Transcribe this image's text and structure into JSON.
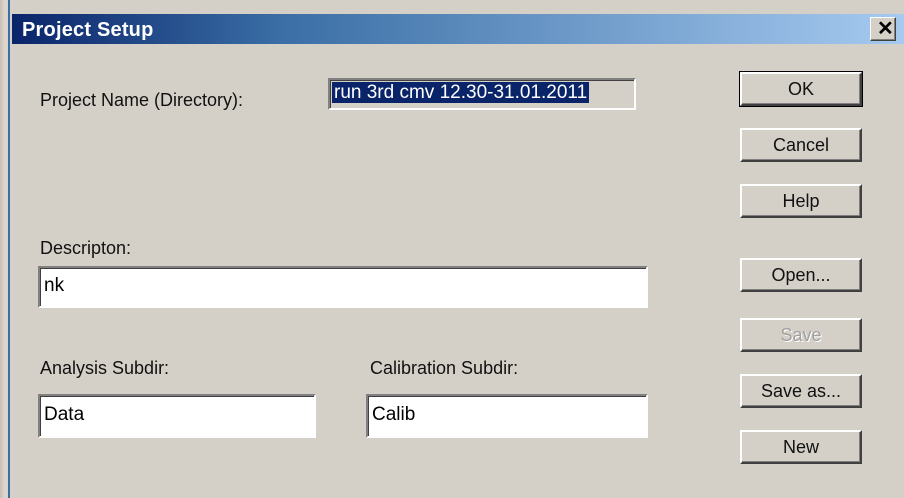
{
  "window": {
    "title": "Project Setup",
    "close_glyph": "✕"
  },
  "fields": {
    "project_name_label": "Project Name (Directory):",
    "project_name_value": "run 3rd cmv 12.30-31.01.2011",
    "description_label": "Descripton:",
    "description_value": "nk",
    "analysis_label": "Analysis Subdir:",
    "analysis_value": "Data",
    "calibration_label": "Calibration Subdir:",
    "calibration_value": "Calib"
  },
  "buttons": {
    "ok": "OK",
    "cancel": "Cancel",
    "help": "Help",
    "open": "Open...",
    "save": "Save",
    "save_as": "Save as...",
    "new": "New"
  }
}
